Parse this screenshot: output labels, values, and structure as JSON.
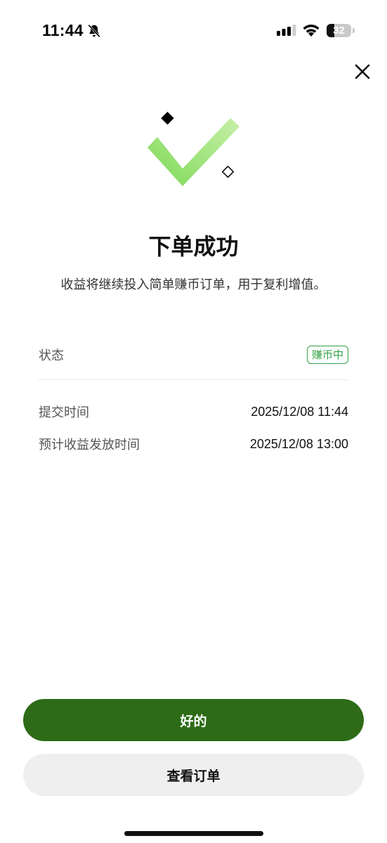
{
  "status_bar": {
    "time": "11:44",
    "battery_level": 32,
    "battery_text": "32",
    "icons": [
      "bell-slash-icon",
      "signal-icon",
      "wifi-icon",
      "battery-icon"
    ]
  },
  "close_icon": "close-icon",
  "illustration": {
    "icon": "checkmark-icon",
    "accent": "#8cd96a"
  },
  "title": "下单成功",
  "subtitle": "收益将继续投入简单赚币订单，用于复利增值。",
  "info": {
    "status": {
      "label": "状态",
      "value": "赚币中",
      "color": "#2ea043"
    },
    "submit_time": {
      "label": "提交时间",
      "value": "2025/12/08 11:44"
    },
    "payout_time": {
      "label": "预计收益发放时间",
      "value": "2025/12/08 13:00"
    }
  },
  "buttons": {
    "ok_label": "好的",
    "ok_color": "#2d6b17",
    "view_order_label": "查看订单"
  }
}
